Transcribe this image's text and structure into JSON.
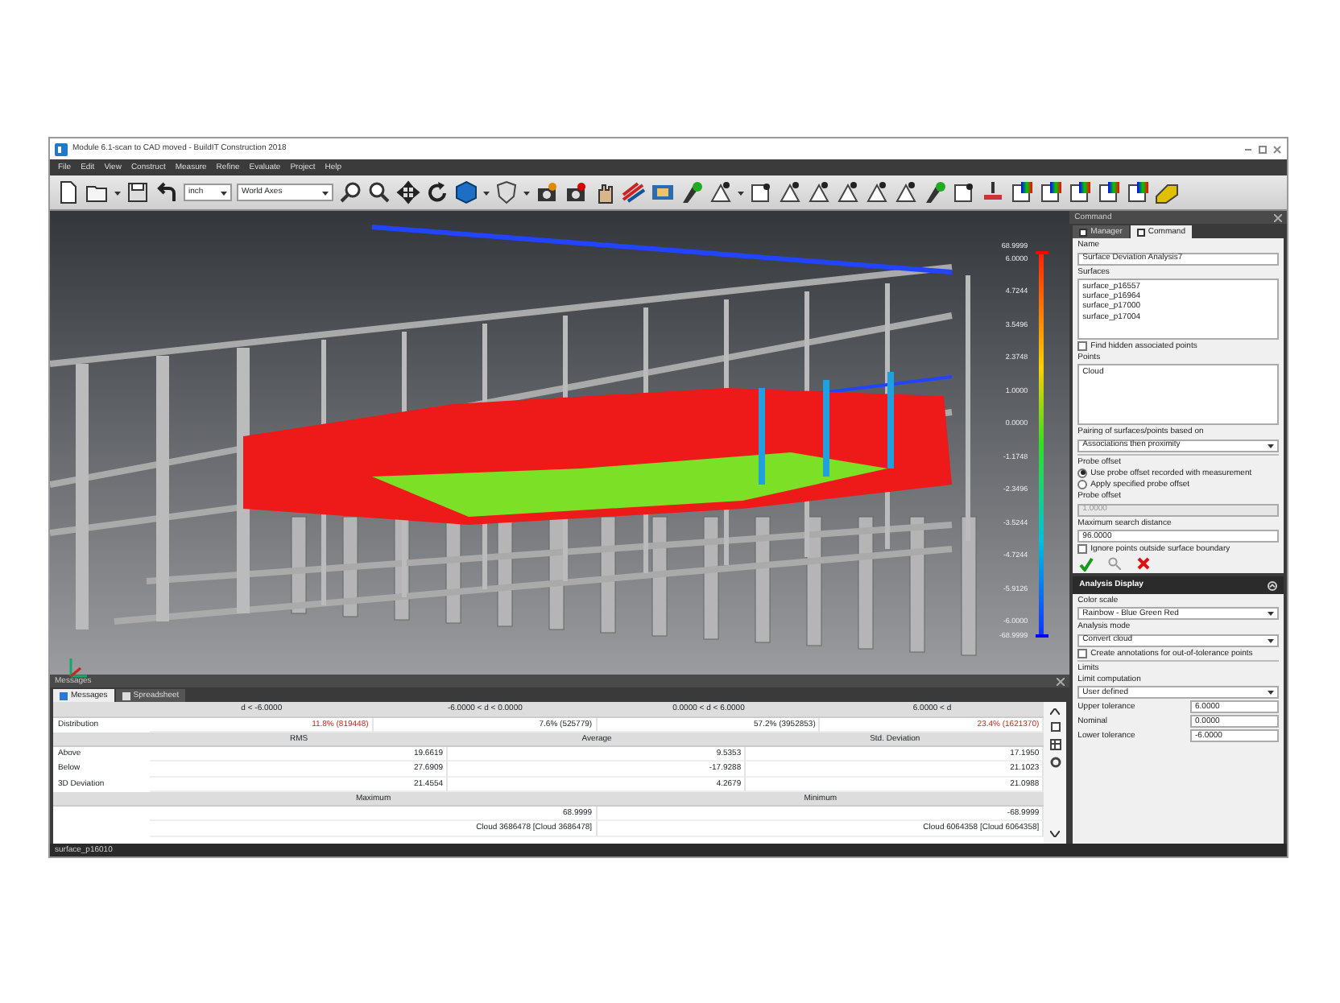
{
  "window": {
    "title": "Module 6.1-scan to CAD moved - BuildIT Construction 2018"
  },
  "menu": [
    "File",
    "Edit",
    "View",
    "Construct",
    "Measure",
    "Refine",
    "Evaluate",
    "Project",
    "Help"
  ],
  "toolbar": {
    "units": "inch",
    "axes": "World Axes"
  },
  "viewport": {
    "scale_labels": [
      "68.9999",
      "6.0000",
      "4.7244",
      "3.5496",
      "2.3748",
      "1.0000",
      "0.0000",
      "-1.1748",
      "-2.3496",
      "-3.5244",
      "-4.7244",
      "-5.9126",
      "-6.0000",
      "-68.9999"
    ]
  },
  "command_panel": {
    "title": "Command",
    "tabs": [
      {
        "label": "Manager",
        "selected": false
      },
      {
        "label": "Command",
        "selected": true
      }
    ],
    "form": [
      {
        "kind": "label",
        "text": "Name"
      },
      {
        "kind": "input",
        "value": "Surface Deviation Analysis7",
        "disabled": false
      },
      {
        "kind": "label",
        "text": "Surfaces"
      },
      {
        "kind": "list",
        "items": [
          "surface_p16557",
          "surface_p16964",
          "surface_p17000",
          "surface_p17004"
        ]
      },
      {
        "kind": "checkbox",
        "label": "Find hidden associated points",
        "checked": false
      },
      {
        "kind": "label",
        "text": "Points"
      },
      {
        "kind": "list",
        "items": [
          "Cloud"
        ]
      },
      {
        "kind": "label",
        "text": "Pairing of surfaces/points based on"
      },
      {
        "kind": "select",
        "value": "Associations then proximity"
      },
      {
        "kind": "group",
        "text": "Probe offset"
      },
      {
        "kind": "radio",
        "label": "Use probe offset recorded with measurement",
        "selected": true
      },
      {
        "kind": "radio",
        "label": "Apply specified probe offset",
        "selected": false
      },
      {
        "kind": "label",
        "text": "Probe offset"
      },
      {
        "kind": "input",
        "value": "1.0000",
        "disabled": true
      },
      {
        "kind": "label",
        "text": "Maximum search distance"
      },
      {
        "kind": "input",
        "value": "96.0000",
        "disabled": false
      },
      {
        "kind": "checkbox",
        "label": "Ignore points outside surface boundary",
        "checked": false
      },
      {
        "kind": "actions"
      }
    ]
  },
  "analysis_display": {
    "title": "Analysis Display",
    "form": [
      {
        "kind": "label",
        "text": "Color scale"
      },
      {
        "kind": "select",
        "value": "Rainbow - Blue Green Red"
      },
      {
        "kind": "label",
        "text": "Analysis mode"
      },
      {
        "kind": "select",
        "value": "Convert cloud"
      },
      {
        "kind": "checkbox",
        "label": "Create annotations for out-of-tolerance points",
        "checked": false
      },
      {
        "kind": "divider",
        "text": "Limits"
      },
      {
        "kind": "label",
        "text": "Limit computation"
      },
      {
        "kind": "select",
        "value": "User defined"
      },
      {
        "kind": "tolerance",
        "label": "Upper tolerance",
        "value": "6.0000"
      },
      {
        "kind": "tolerance",
        "label": "Nominal",
        "value": "0.0000"
      },
      {
        "kind": "tolerance",
        "label": "Lower tolerance",
        "value": "-6.0000"
      }
    ]
  },
  "messages": {
    "title": "Messages",
    "tabs": [
      {
        "label": "Messages",
        "selected": true
      },
      {
        "label": "Spreadsheet",
        "selected": false
      }
    ],
    "table": [
      {
        "kind": "header",
        "cells": [
          {
            "text": "d < -6.0000"
          },
          {
            "text": "-6.0000 < d < 0.0000"
          },
          {
            "text": "0.0000 < d < 6.0000"
          },
          {
            "text": "6.0000 < d"
          }
        ]
      },
      {
        "kind": "data",
        "label": "Distribution",
        "cells": [
          {
            "text": "11.8% (819448)",
            "out_of_tolerance": true
          },
          {
            "text": "7.6% (525779)",
            "out_of_tolerance": false
          },
          {
            "text": "57.2% (3952853)",
            "out_of_tolerance": false
          },
          {
            "text": "23.4% (1621370)",
            "out_of_tolerance": true
          }
        ]
      },
      {
        "kind": "header",
        "cells": [
          {
            "text": "RMS"
          },
          {
            "text": "Average"
          },
          {
            "text": "Std. Deviation"
          }
        ]
      },
      {
        "kind": "data",
        "label": "Above",
        "cells": [
          {
            "text": "19.6619"
          },
          {
            "text": "9.5353"
          },
          {
            "text": "17.1950"
          }
        ]
      },
      {
        "kind": "data",
        "label": "Below",
        "cells": [
          {
            "text": "27.6909"
          },
          {
            "text": "-17.9288"
          },
          {
            "text": "21.1023"
          }
        ]
      },
      {
        "kind": "data",
        "label": "3D Deviation",
        "cells": [
          {
            "text": "21.4554"
          },
          {
            "text": "4.2679"
          },
          {
            "text": "21.0988"
          }
        ]
      },
      {
        "kind": "header",
        "cells": [
          {
            "text": "Maximum"
          },
          {
            "text": "Minimum"
          }
        ]
      },
      {
        "kind": "data",
        "cells": [
          {
            "text": "68.9999"
          },
          {
            "text": "-68.9999"
          }
        ]
      },
      {
        "kind": "data",
        "cells": [
          {
            "text": "Cloud 3686478 [Cloud 3686478]"
          },
          {
            "text": "Cloud 6064358 [Cloud 6064358]"
          }
        ]
      }
    ]
  },
  "status_bar": {
    "text": "surface_p16010"
  }
}
